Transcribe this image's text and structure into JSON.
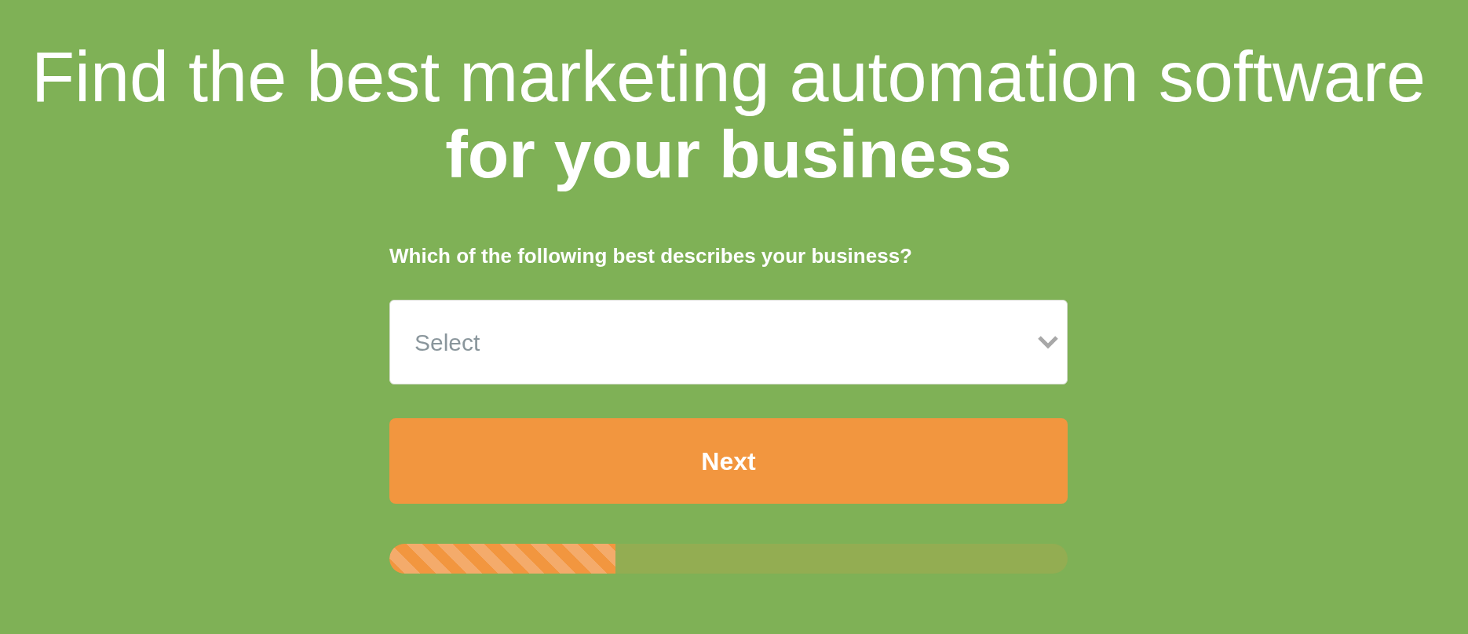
{
  "heading": {
    "line_1": "Find the best marketing automation software",
    "line_2": "for your business"
  },
  "question": {
    "label": "Which of the following best describes your business?",
    "select": {
      "placeholder": "Select"
    }
  },
  "next_button": {
    "label": "Next"
  },
  "progress": {
    "level": 0.333
  }
}
